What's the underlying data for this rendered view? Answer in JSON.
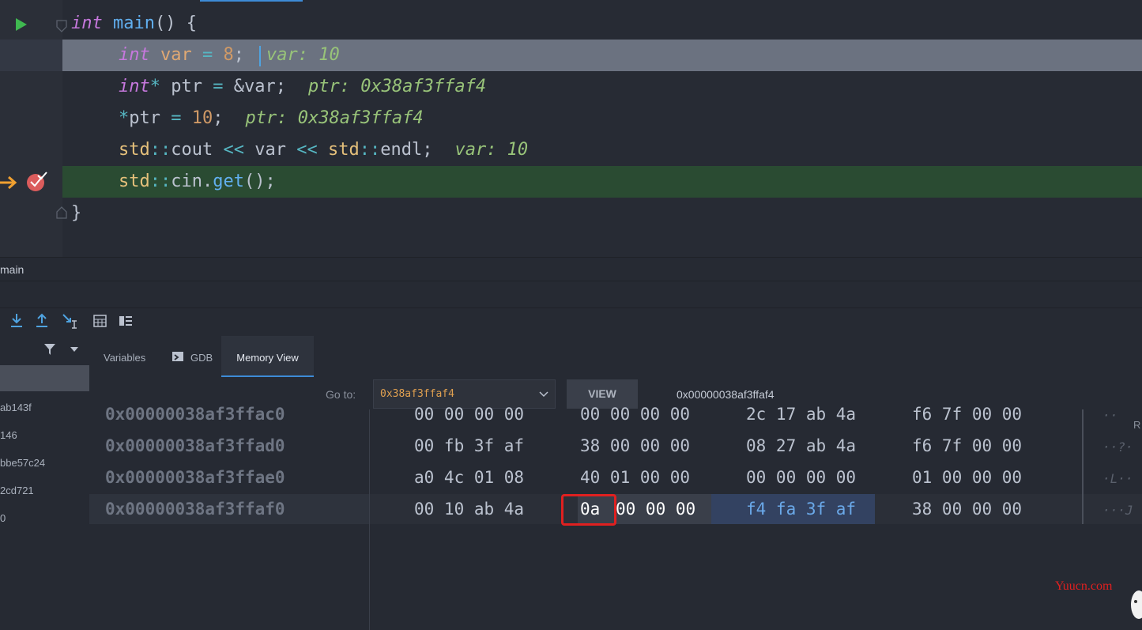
{
  "editor": {
    "lines": [
      {
        "id": "l1",
        "tokens": [
          [
            "kw",
            "int"
          ],
          [
            "plain",
            " "
          ],
          [
            "fn",
            "main"
          ],
          [
            "plain",
            "() {"
          ]
        ]
      },
      {
        "id": "l2",
        "tokens": [
          [
            "kw",
            "int"
          ],
          [
            "plain",
            " "
          ],
          [
            "var",
            "var"
          ],
          [
            "plain",
            " "
          ],
          [
            "op",
            "="
          ],
          [
            "plain",
            " "
          ],
          [
            "num",
            "8"
          ],
          [
            "plain",
            ";"
          ]
        ],
        "hint": "var: 10"
      },
      {
        "id": "l3",
        "tokens": [
          [
            "kw",
            "int"
          ],
          [
            "op",
            "*"
          ],
          [
            "plain",
            " ptr "
          ],
          [
            "op",
            "="
          ],
          [
            "plain",
            " &var;"
          ]
        ],
        "hint": "ptr: 0x38af3ffaf4"
      },
      {
        "id": "l4",
        "tokens": [
          [
            "op",
            "*"
          ],
          [
            "plain",
            "ptr "
          ],
          [
            "op",
            "="
          ],
          [
            "plain",
            " "
          ],
          [
            "num",
            "10"
          ],
          [
            "plain",
            ";"
          ]
        ],
        "hint": "ptr: 0x38af3ffaf4"
      },
      {
        "id": "l5",
        "tokens": [
          [
            "ty",
            "std"
          ],
          [
            "op",
            "::"
          ],
          [
            "plain",
            "cout "
          ],
          [
            "op",
            "<<"
          ],
          [
            "plain",
            " var "
          ],
          [
            "op",
            "<<"
          ],
          [
            "plain",
            " "
          ],
          [
            "ty",
            "std"
          ],
          [
            "op",
            "::"
          ],
          [
            "plain",
            "endl;"
          ]
        ],
        "hint": "var: 10"
      },
      {
        "id": "l6",
        "tokens": [
          [
            "ty",
            "std"
          ],
          [
            "op",
            "::"
          ],
          [
            "plain",
            "cin."
          ],
          [
            "fn",
            "get"
          ],
          [
            "plain",
            "();"
          ]
        ]
      },
      {
        "id": "l7",
        "tokens": [
          [
            "plain",
            "}"
          ]
        ]
      }
    ]
  },
  "breadcrumb": "main",
  "frames": [
    "ab143f",
    "146",
    "bbe57c24",
    "2cd721",
    "0"
  ],
  "tabs": {
    "variables": "Variables",
    "gdb": "GDB",
    "memory": "Memory View"
  },
  "memory": {
    "goto_label": "Go to:",
    "goto_value": "0x38af3ffaf4",
    "view_button": "VIEW",
    "current_address": "0x00000038af3ffaf4",
    "rows": [
      {
        "addr": "0x00000038af3ffac0",
        "g1": "00 00 00 00",
        "g2": "00 00 00 00",
        "g3": "2c 17 ab 4a",
        "g4": "f6 7f 00 00",
        "ascii": "··"
      },
      {
        "addr": "0x00000038af3ffad0",
        "g1": "00 fb 3f af",
        "g2": "38 00 00 00",
        "g3": "08 27 ab 4a",
        "g4": "f6 7f 00 00",
        "ascii": "··?·"
      },
      {
        "addr": "0x00000038af3ffae0",
        "g1": "a0 4c 01 08",
        "g2": "40 01 00 00",
        "g3": "00 00 00 00",
        "g4": "01 00 00 00",
        "ascii": "·L··"
      },
      {
        "addr": "0x00000038af3ffaf0",
        "g1": "00 10 ab 4a",
        "g2a": "0a",
        "g2b": "00 00 00",
        "g3": "f4 fa 3f af",
        "g4": "38 00 00 00",
        "ascii": "···J"
      }
    ],
    "ascii_header": "R"
  },
  "watermark": "Yuucn.com",
  "colors": {
    "accent": "#3d8bd7",
    "exec_line": "#2a4b32",
    "selected_line": "#6b7280",
    "breakpoint": "#db5c5c",
    "arrow": "#f0a030",
    "highlight_box": "#e02020"
  }
}
